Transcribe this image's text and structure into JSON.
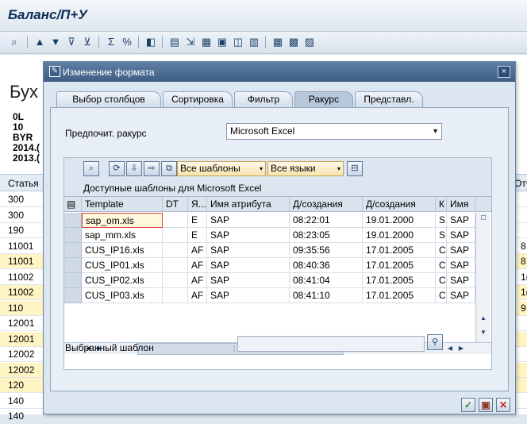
{
  "window": {
    "title": "Баланс/П+У"
  },
  "background": {
    "heading": "Бух",
    "info_lines": [
      "0L",
      "10",
      "BYR",
      "2014.(",
      "2013.("
    ],
    "column_header": "Статья",
    "column_header_right": "Отч",
    "rows": [
      {
        "value": "300",
        "right": "",
        "highlight": false
      },
      {
        "value": "300",
        "right": "",
        "highlight": false
      },
      {
        "value": "190",
        "right": "",
        "highlight": false
      },
      {
        "value": "11001",
        "right": "8",
        "highlight": false
      },
      {
        "value": "11001",
        "right": "8",
        "highlight": true
      },
      {
        "value": "11002",
        "right": "1(",
        "highlight": false
      },
      {
        "value": "11002",
        "right": "1(",
        "highlight": true
      },
      {
        "value": "110",
        "right": "9",
        "highlight": true
      },
      {
        "value": "12001",
        "right": "",
        "highlight": false
      },
      {
        "value": "12001",
        "right": "",
        "highlight": true
      },
      {
        "value": "12002",
        "right": "",
        "highlight": false
      },
      {
        "value": "12002",
        "right": "",
        "highlight": true
      },
      {
        "value": "120",
        "right": "",
        "highlight": true
      },
      {
        "value": "140",
        "right": "",
        "highlight": false
      },
      {
        "value": "140",
        "right": "",
        "highlight": false
      }
    ]
  },
  "dialog": {
    "title": "Изменение формата",
    "close_icon": "×",
    "tabs": [
      {
        "label": "Выбор столбцов",
        "active": false
      },
      {
        "label": "Сортировка",
        "active": false
      },
      {
        "label": "Фильтр",
        "active": false
      },
      {
        "label": "Ракурс",
        "active": true
      },
      {
        "label": "Представл.",
        "active": false
      }
    ],
    "preferred_view": {
      "label": "Предпочит. ракурс",
      "value": "Microsoft Excel"
    },
    "grid_toolbar": {
      "templates_filter": "Все шаблоны",
      "languages_filter": "Все языки"
    },
    "grid_caption": "Доступные шаблоны для Microsoft Excel",
    "grid": {
      "columns": [
        "Template",
        "DT",
        "Я...",
        "Имя атрибута",
        "Д/создания",
        "Д/создания",
        "К",
        "Имя"
      ],
      "rows": [
        [
          "sap_om.xls",
          "",
          "E",
          "SAP",
          "08:22:01",
          "19.01.2000",
          "S",
          "SAP"
        ],
        [
          "sap_mm.xls",
          "",
          "E",
          "SAP",
          "08:23:05",
          "19.01.2000",
          "S",
          "SAP"
        ],
        [
          "CUS_IP16.xls",
          "",
          "AF",
          "SAP",
          "09:35:56",
          "17.01.2005",
          "C",
          "SAP"
        ],
        [
          "CUS_IP01.xls",
          "",
          "AF",
          "SAP",
          "08:40:36",
          "17.01.2005",
          "C",
          "SAP"
        ],
        [
          "CUS_IP02.xls",
          "",
          "AF",
          "SAP",
          "08:41:04",
          "17.01.2005",
          "C",
          "SAP"
        ],
        [
          "CUS_IP03.xls",
          "",
          "AF",
          "SAP",
          "08:41:10",
          "17.01.2005",
          "C",
          "SAP"
        ]
      ]
    },
    "selected_template": {
      "label": "Выбранный шаблон",
      "value": ""
    }
  },
  "colors": {
    "title_bar": "#4a6a93",
    "highlight_row": "#fff4c4",
    "accept_green": "#2e8b2e",
    "cancel_red": "#cc2222"
  }
}
